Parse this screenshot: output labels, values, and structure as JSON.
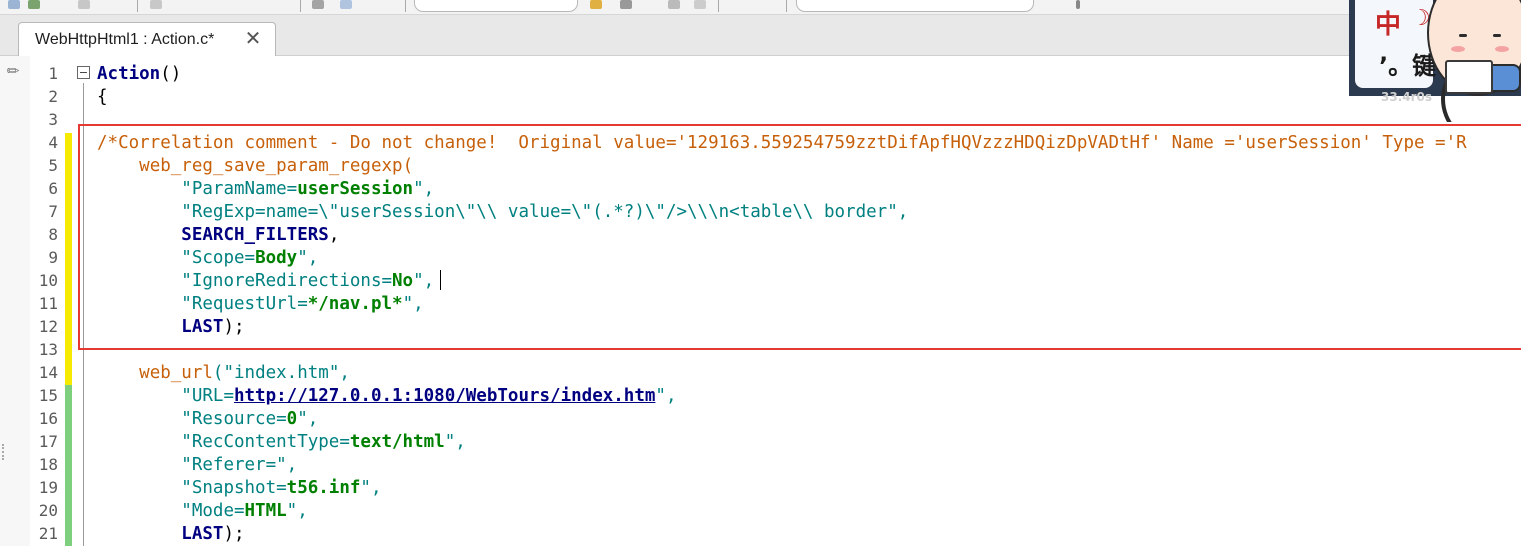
{
  "editor_tab": {
    "title": "WebHttpHtml1 : Action.c*",
    "close_glyph": "✕"
  },
  "line_numbers": [
    "1",
    "2",
    "3",
    "4",
    "5",
    "6",
    "7",
    "8",
    "9",
    "10",
    "11",
    "12",
    "13",
    "14",
    "15",
    "16",
    "17",
    "18",
    "19",
    "20",
    "21"
  ],
  "code": {
    "l1_fn": "Action",
    "l1_parens": "()",
    "l2": "{",
    "l4_comment": "/*Correlation comment - Do not change!  Original value='129163.559254759zztDifApfHQVzzzHDQizDpVADtHf' Name ='userSession' Type ='R",
    "l5_fn": "web_reg_save_param_regexp",
    "l5_paren": "(",
    "l6_key": "\"ParamName=",
    "l6_val": "userSession",
    "l6_end": "\",",
    "l7_key": "\"RegExp=name=\\\"userSession\\\"\\\\ value=\\\"(.*?)\\\"/>\\\\\\n<table\\\\ border\",",
    "l8_kw": "SEARCH_FILTERS",
    "l8_end": ",",
    "l9_key": "\"Scope=",
    "l9_val": "Body",
    "l9_end": "\",",
    "l10_key": "\"IgnoreRedirections=",
    "l10_val": "No",
    "l10_end": "\",",
    "l11_key": "\"RequestUrl=",
    "l11_val": "*/nav.pl*",
    "l11_end": "\",",
    "l12_kw": "LAST",
    "l12_end": ");",
    "l14_fn": "web_url",
    "l14_rest": "(\"index.htm\",",
    "l15_key": "\"URL=",
    "l15_link": "http://127.0.0.1:1080/WebTours/index.htm",
    "l15_end": "\",",
    "l16_key": "\"Resource=",
    "l16_val": "0",
    "l16_end": "\",",
    "l17_key": "\"RecContentType=",
    "l17_val": "text/html",
    "l17_end": "\",",
    "l18": "\"Referer=\",",
    "l19_key": "\"Snapshot=",
    "l19_val": "t56.inf",
    "l19_end": "\",",
    "l20_key": "\"Mode=",
    "l20_val": "HTML",
    "l20_end": "\",",
    "l21_kw": "LAST",
    "l21_end": ");"
  },
  "ime_overlay": {
    "char_top": "中",
    "moon": "☽",
    "char_bottom": "’。键",
    "speed_text": "33.4r0s"
  },
  "colors": {
    "change_modified": "#f5ea00",
    "change_saved": "#7ed07e",
    "highlight_border": "#e53935",
    "keyword": "#000080",
    "function": "#c7600a",
    "string": "#008080",
    "string_value": "#008000"
  }
}
